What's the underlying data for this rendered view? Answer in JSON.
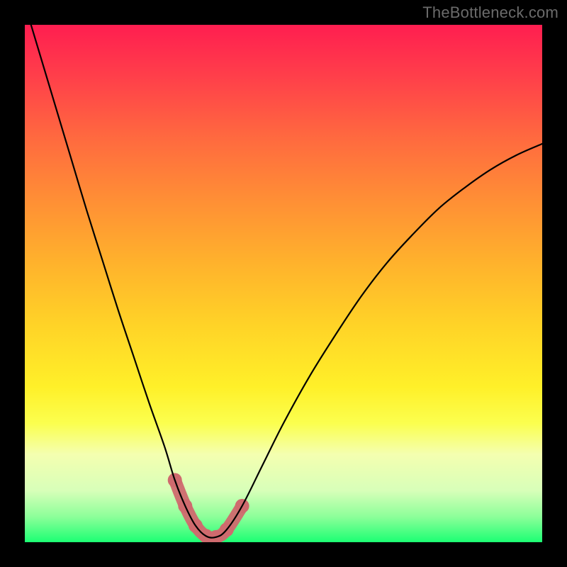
{
  "watermark": "TheBottleneck.com",
  "colors": {
    "background": "#000000",
    "curve": "#000000",
    "valley_marker": "#cf6a6e",
    "gradient_stops": [
      "#ff1e50",
      "#ff3f4a",
      "#ff6a3f",
      "#ff8f35",
      "#ffb22c",
      "#ffd327",
      "#fff029",
      "#fbff4e",
      "#f4ffb0",
      "#d8ffb9",
      "#8eff9a",
      "#1cff73"
    ]
  },
  "chart_data": {
    "type": "line",
    "title": "",
    "xlabel": "",
    "ylabel": "",
    "xlim": [
      0,
      100
    ],
    "ylim": [
      0,
      100
    ],
    "legend": false,
    "grid": false,
    "series": [
      {
        "name": "bottleneck-curve",
        "x": [
          0,
          3,
          6,
          9,
          12,
          15,
          18,
          21,
          24,
          27,
          29,
          31,
          33,
          35,
          37,
          39,
          42,
          46,
          50,
          55,
          60,
          65,
          70,
          75,
          80,
          85,
          90,
          95,
          100
        ],
        "y": [
          104,
          94,
          84,
          74,
          64,
          54.5,
          45,
          36,
          27,
          18.5,
          12,
          7,
          3.2,
          1.2,
          1.0,
          2.4,
          7,
          15,
          23,
          32,
          40,
          47.5,
          54,
          59.5,
          64.5,
          68.5,
          72,
          74.8,
          77
        ]
      }
    ],
    "annotations": [
      {
        "name": "valley-marker",
        "x_range": [
          29,
          42
        ],
        "y_range": [
          1.0,
          12
        ],
        "description": "U-shaped highlighted segment at the curve minimum"
      }
    ]
  }
}
